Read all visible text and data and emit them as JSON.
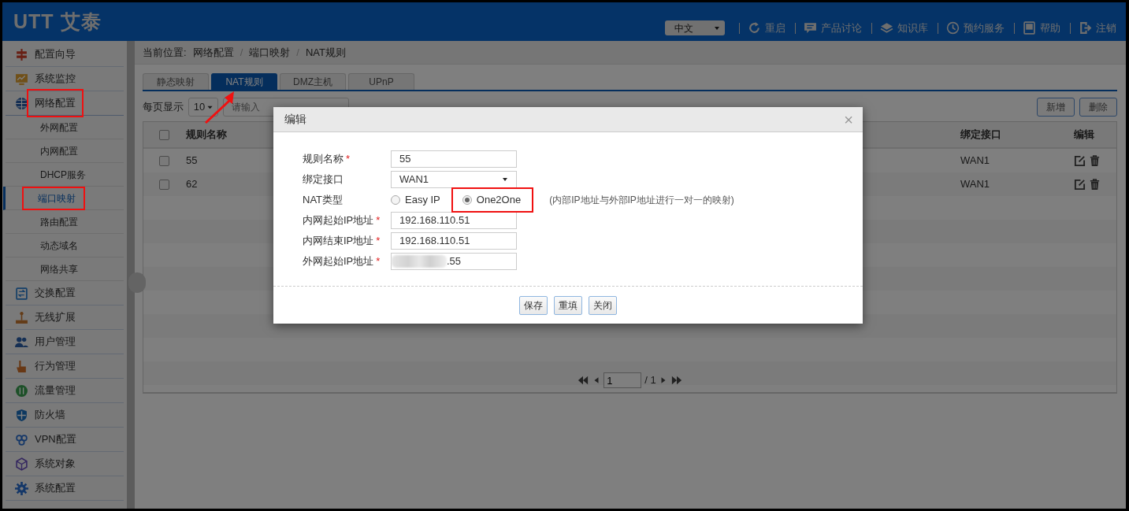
{
  "header": {
    "logo": "UTT 艾泰",
    "language": "中文",
    "links": [
      {
        "label": "重启"
      },
      {
        "label": "产品讨论"
      },
      {
        "label": "知识库"
      },
      {
        "label": "预约服务"
      },
      {
        "label": "帮助"
      },
      {
        "label": "注销"
      }
    ]
  },
  "sidebar": {
    "items": [
      {
        "label": "配置向导"
      },
      {
        "label": "系统监控"
      },
      {
        "label": "网络配置",
        "expanded": true,
        "annotated": true,
        "children": [
          {
            "label": "外网配置",
            "selected": false,
            "annotated": false
          },
          {
            "label": "内网配置",
            "selected": false,
            "annotated": false
          },
          {
            "label": "DHCP服务",
            "selected": false,
            "annotated": false
          },
          {
            "label": "端口映射",
            "selected": true,
            "annotated": true
          },
          {
            "label": "路由配置",
            "selected": false,
            "annotated": false
          },
          {
            "label": "动态域名",
            "selected": false,
            "annotated": false
          },
          {
            "label": "网络共享",
            "selected": false,
            "annotated": false
          }
        ]
      },
      {
        "label": "交换配置"
      },
      {
        "label": "无线扩展"
      },
      {
        "label": "用户管理"
      },
      {
        "label": "行为管理"
      },
      {
        "label": "流量管理"
      },
      {
        "label": "防火墙"
      },
      {
        "label": "VPN配置"
      },
      {
        "label": "系统对象"
      },
      {
        "label": "系统配置"
      }
    ]
  },
  "breadcrumb": {
    "label": "当前位置:",
    "separator": "/",
    "items": [
      "网络配置",
      "端口映射",
      "NAT规则"
    ]
  },
  "tabs": [
    {
      "label": "静态映射",
      "selected": false,
      "pointed": false
    },
    {
      "label": "NAT规则",
      "selected": true,
      "pointed": true
    },
    {
      "label": "DMZ主机",
      "selected": false,
      "pointed": false
    },
    {
      "label": "UPnP",
      "selected": false,
      "pointed": false
    }
  ],
  "toolbar": {
    "page_size_label": "每页显示",
    "page_size": "10",
    "search": {
      "placeholder": "请输入"
    },
    "buttons": [
      "新增",
      "删除"
    ]
  },
  "table": {
    "select_all_checked": false,
    "columns": [
      "规则名称",
      "绑定接口",
      "编辑"
    ],
    "rows": [
      {
        "name": "55",
        "interface": "WAN1",
        "checked": false
      },
      {
        "name": "62",
        "interface": "WAN1",
        "checked": false
      }
    ]
  },
  "pager": {
    "page": "1",
    "total": "/ 1"
  },
  "dialog": {
    "title": "编辑",
    "close": "×",
    "fields": [
      {
        "kind": "text",
        "label": "规则名称",
        "required_mark": "*",
        "value": "55"
      },
      {
        "kind": "select",
        "label": "绑定接口",
        "value": "WAN1"
      },
      {
        "kind": "radio",
        "label": "NAT类型",
        "options": [
          {
            "label": "Easy IP",
            "selected": false
          },
          {
            "label": "One2One",
            "selected": true,
            "annotated": true
          }
        ],
        "hint": "(内部IP地址与外部IP地址进行一对一的映射)"
      },
      {
        "kind": "text",
        "label": "内网起始IP地址",
        "required_mark": "*",
        "value": "192.168.110.51"
      },
      {
        "kind": "text",
        "label": "内网结束IP地址",
        "required_mark": "*",
        "value": "192.168.110.51"
      },
      {
        "kind": "text",
        "label": "外网起始IP地址",
        "required_mark": "*",
        "value": ".55",
        "redacted": true
      }
    ],
    "buttons": [
      "保存",
      "重填",
      "关闭"
    ]
  }
}
